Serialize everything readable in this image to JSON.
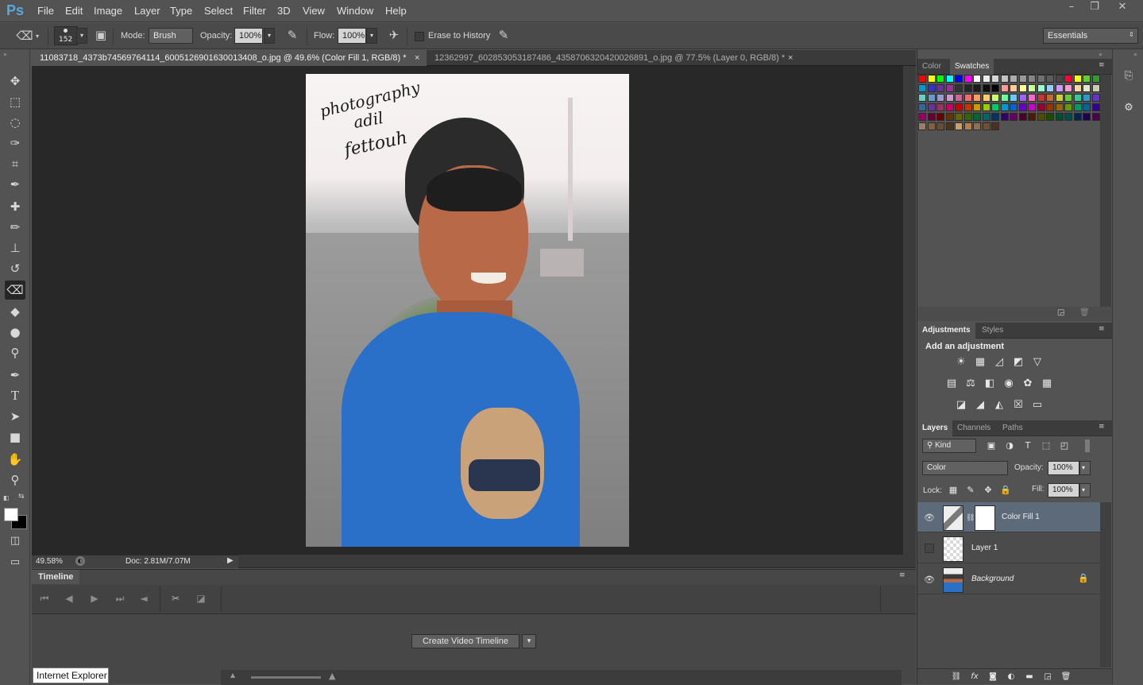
{
  "app": {
    "logo": "Ps"
  },
  "menu": [
    "File",
    "Edit",
    "Image",
    "Layer",
    "Type",
    "Select",
    "Filter",
    "3D",
    "View",
    "Window",
    "Help"
  ],
  "window_controls": [
    "–",
    "❐",
    "✕"
  ],
  "options": {
    "brush_size": "152",
    "mode_label": "Mode:",
    "mode_value": "Brush",
    "opacity_label": "Opacity:",
    "opacity_value": "100%",
    "flow_label": "Flow:",
    "flow_value": "100%",
    "erase_history": "Erase to History",
    "workspace": "Essentials"
  },
  "doc_tabs": [
    {
      "label": "11083718_4373b74569764114_6005126901630013408_o.jpg @ 49.6% (Color Fill 1, RGB/8) *"
    },
    {
      "label": "12362997_602853053187486_4358706320420026891_o.jpg @ 77.5% (Layer 0, RGB/8) *"
    }
  ],
  "tab_close": "×",
  "canvas_text": {
    "line1": "photography",
    "line2": "adil",
    "line3": "fettouh"
  },
  "status": {
    "zoom": "49.58%",
    "doc": "Doc: 2.81M/7.07M"
  },
  "timeline": {
    "title": "Timeline",
    "create_button": "Create Video Timeline"
  },
  "tooltip": "Internet Explorer",
  "panels": {
    "color_tab": "Color",
    "swatches_tab": "Swatches",
    "adjustments_tab": "Adjustments",
    "styles_tab": "Styles",
    "add_adjustment": "Add an adjustment",
    "layers_tab": "Layers",
    "channels_tab": "Channels",
    "paths_tab": "Paths",
    "filter_kind": "Kind",
    "blend_mode": "Color",
    "opacity_label": "Opacity:",
    "opacity_value": "100%",
    "lock_label": "Lock:",
    "fill_label": "Fill:",
    "fill_value": "100%"
  },
  "layers": [
    {
      "name": "Color Fill 1",
      "visible": true,
      "selected": true
    },
    {
      "name": "Layer 1",
      "visible": false,
      "selected": false
    },
    {
      "name": "Background",
      "visible": true,
      "selected": false,
      "locked": true
    }
  ],
  "colors": {
    "accent_logo": "#5aa7e0",
    "selected_layer": "#5d6a7a",
    "shirt_blue": "#2a6fc8"
  }
}
